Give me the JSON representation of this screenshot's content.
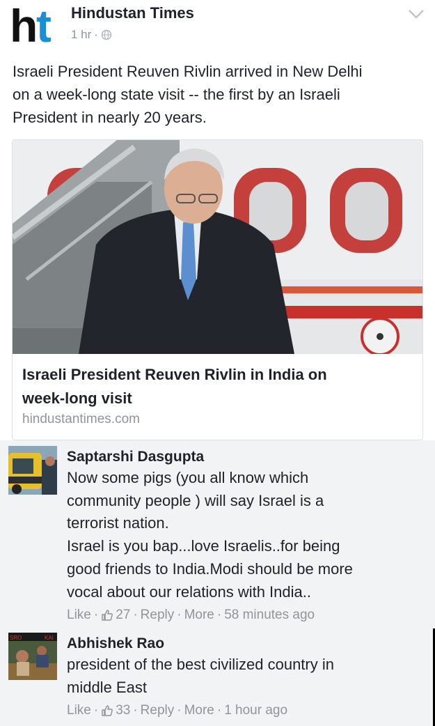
{
  "post": {
    "page_name": "Hindustan Times",
    "logo_text": "ht",
    "time": "1 hr",
    "separator": "·",
    "text_lines": [
      "Israeli President Reuven Rivlin arrived in New Delhi",
      "on a week-long state visit -- the first by an Israeli",
      "President in nearly 20 years."
    ],
    "link_card": {
      "title_lines": [
        "Israeli President Reuven Rivlin in India on",
        "week-long visit"
      ],
      "domain": "hindustantimes.com"
    }
  },
  "comments": [
    {
      "author": "Saptarshi Dasgupta",
      "text_lines": [
        "Now some pigs (you all know which",
        "community people ) will say Israel is a",
        "terrorist nation.",
        "Israel is you bap...love Israelis..for being",
        "good friends to India.Modi should be more",
        "vocal about our relations with India.."
      ],
      "like_label": "Like",
      "like_count": "27",
      "reply_label": "Reply",
      "more_label": "More",
      "time": "58 minutes ago"
    },
    {
      "author": "Abhishek Rao",
      "text_lines": [
        "president of the best civilized country in",
        "middle East"
      ],
      "like_label": "Like",
      "like_count": "33",
      "reply_label": "Reply",
      "more_label": "More",
      "time": "1 hour ago"
    }
  ],
  "icons": {
    "privacy": "globe-icon",
    "options": "chevron-down-icon",
    "like_count": "thumbs-up-icon"
  },
  "colors": {
    "text": "#1d2129",
    "meta": "#90949c",
    "comment_bg": "#f2f3f5",
    "logo_accent": "#1a8fd6"
  }
}
